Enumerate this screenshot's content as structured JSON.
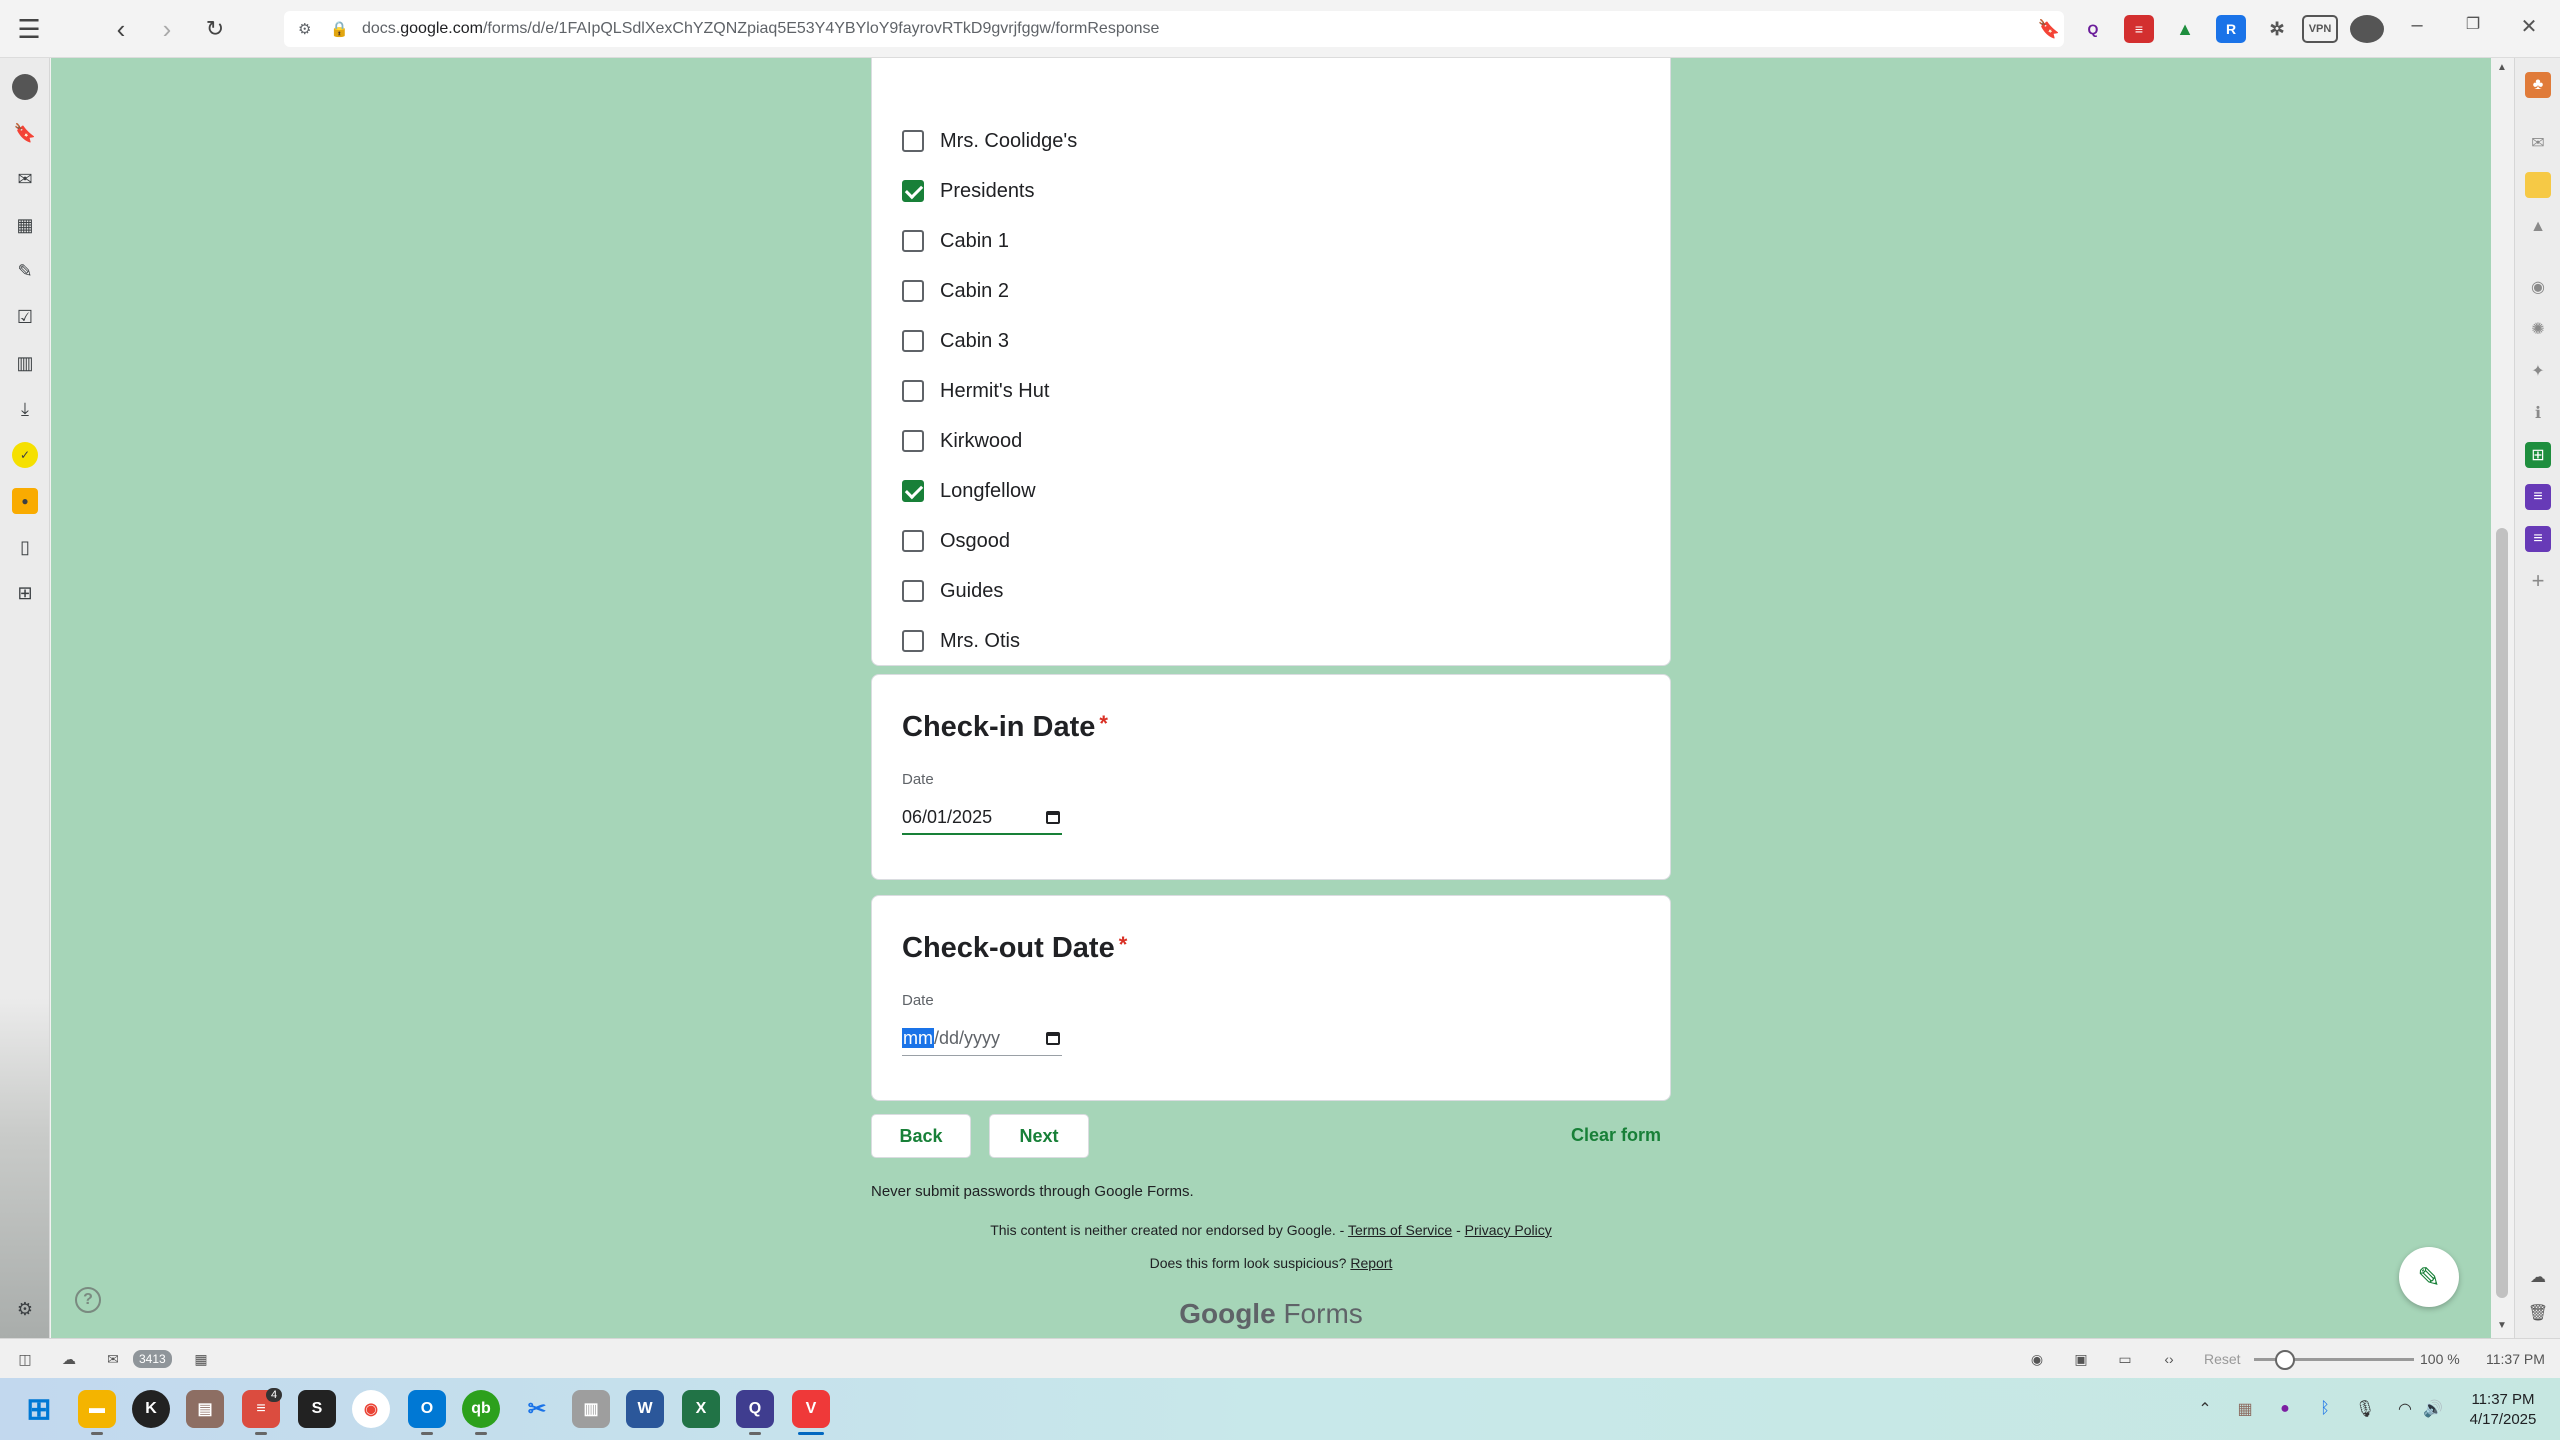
{
  "browser": {
    "url_prefix": "docs.",
    "url_domain": "google.com",
    "url_path": "/forms/d/e/1FAIpQLSdlXexChYZQNZpiaq5E53Y4YBYloY9fayrovRTkD9gvrjfggw/formResponse"
  },
  "form": {
    "options": [
      {
        "label": "Mrs. Coolidge's",
        "checked": false
      },
      {
        "label": "Presidents",
        "checked": true
      },
      {
        "label": "Cabin 1",
        "checked": false
      },
      {
        "label": "Cabin 2",
        "checked": false
      },
      {
        "label": "Cabin 3",
        "checked": false
      },
      {
        "label": "Hermit's Hut",
        "checked": false
      },
      {
        "label": "Kirkwood",
        "checked": false
      },
      {
        "label": "Longfellow",
        "checked": true
      },
      {
        "label": "Osgood",
        "checked": false
      },
      {
        "label": "Guides",
        "checked": false
      },
      {
        "label": "Mrs. Otis",
        "checked": false
      }
    ],
    "checkin": {
      "title": "Check-in Date",
      "required_mark": "*",
      "sublabel": "Date",
      "value": "06/01/2025"
    },
    "checkout": {
      "title": "Check-out Date",
      "required_mark": "*",
      "sublabel": "Date",
      "placeholder_mm": "mm",
      "placeholder_rest": "/dd/yyyy"
    },
    "back_label": "Back",
    "next_label": "Next",
    "clear_label": "Clear form",
    "password_note": "Never submit passwords through Google Forms.",
    "disclaimer": "This content is neither created nor endorsed by Google. -",
    "terms_label": "Terms of Service",
    "separator": "-",
    "privacy_label": "Privacy Policy",
    "suspicious_text": "Does this form look suspicious?",
    "report_label": "Report",
    "brand_google": "Google",
    "brand_forms": "Forms"
  },
  "statusbar": {
    "mail_count": "3413",
    "reset_label": "Reset",
    "zoom": "100 %",
    "time": "11:37 PM"
  },
  "taskbar": {
    "badge_count": "4",
    "clock_time": "11:37 PM",
    "clock_date": "4/17/2025"
  }
}
